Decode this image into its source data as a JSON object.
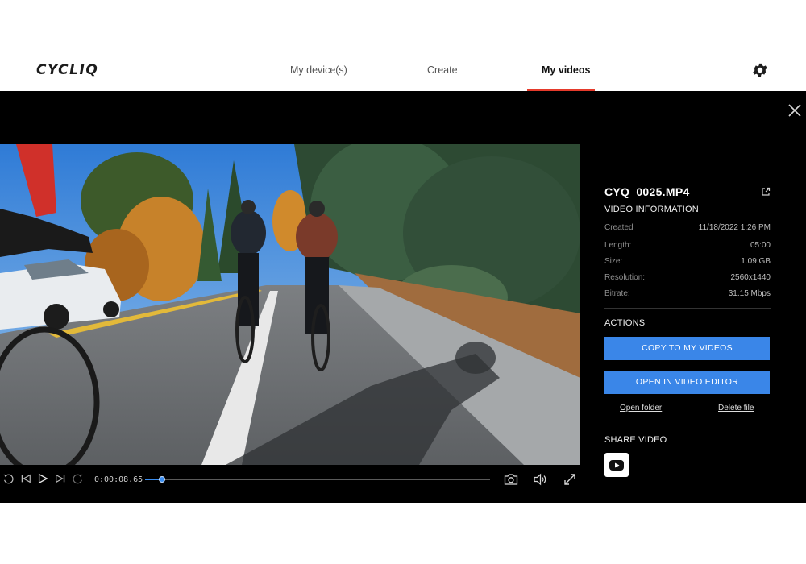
{
  "header": {
    "logo": "CYCLIQ",
    "nav": [
      {
        "label": "My device(s)",
        "active": false
      },
      {
        "label": "Create",
        "active": false
      },
      {
        "label": "My videos",
        "active": true
      }
    ],
    "accent_color": "#e53a2b",
    "settings_icon": "gear-icon"
  },
  "player": {
    "timecode": "0:00:08.65",
    "progress": 0.05,
    "controls": [
      "replay-icon",
      "skip-back-icon",
      "play-icon",
      "skip-forward-icon",
      "forward-icon"
    ],
    "right_controls": [
      "camera-icon",
      "volume-icon",
      "fullscreen-icon"
    ]
  },
  "panel": {
    "file_name": "CYQ_0025.MP4",
    "info_title": "VIDEO INFORMATION",
    "info": [
      {
        "label": "Created",
        "value": "11/18/2022 1:26 PM"
      },
      {
        "label": "Length:",
        "value": "05:00"
      },
      {
        "label": "Size:",
        "value": "1.09 GB"
      },
      {
        "label": "Resolution:",
        "value": "2560x1440"
      },
      {
        "label": "Bitrate:",
        "value": "31.15 Mbps"
      }
    ],
    "actions_title": "ACTIONS",
    "copy_button": "COPY TO MY VIDEOS",
    "editor_button": "OPEN IN VIDEO EDITOR",
    "open_folder": "Open folder",
    "delete_file": "Delete file",
    "share_title": "SHARE VIDEO",
    "button_color": "#3a86e8"
  }
}
